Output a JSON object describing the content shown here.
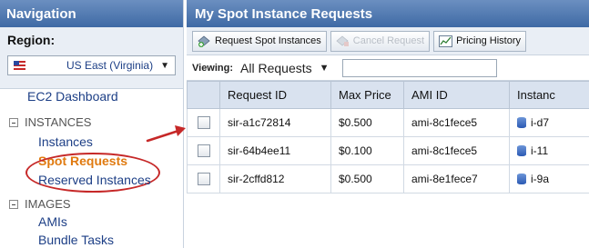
{
  "nav": {
    "title": "Navigation",
    "region_label": "Region:",
    "region_value": "US East (Virginia)",
    "links": {
      "ec2_dashboard": "EC2 Dashboard",
      "instances_section": "INSTANCES",
      "instances": "Instances",
      "spot_requests": "Spot Requests",
      "reserved_instances": "Reserved Instances",
      "images_section": "IMAGES",
      "amis": "AMIs",
      "bundle_tasks": "Bundle Tasks"
    }
  },
  "main": {
    "title": "My Spot Instance Requests",
    "toolbar": {
      "request_spot": "Request Spot Instances",
      "cancel_request": "Cancel Request",
      "pricing_history": "Pricing History"
    },
    "viewing_label": "Viewing:",
    "view_value": "All Requests",
    "filter_value": "",
    "columns": [
      "Request ID",
      "Max Price",
      "AMI ID",
      "Instanc"
    ],
    "rows": [
      {
        "request_id": "sir-a1c72814",
        "max_price": "$0.500",
        "ami_id": "ami-8c1fece5",
        "instance": "i-d7"
      },
      {
        "request_id": "sir-64b4ee11",
        "max_price": "$0.100",
        "ami_id": "ami-8c1fece5",
        "instance": "i-11"
      },
      {
        "request_id": "sir-2cffd812",
        "max_price": "$0.500",
        "ami_id": "ami-8e1fece7",
        "instance": "i-9a"
      }
    ]
  },
  "colors": {
    "header_blue": "#3f6aa5",
    "panel_bg": "#e9eef5",
    "highlight_red": "#c62828",
    "active_link": "#e07a10",
    "link_blue": "#1d3f86"
  }
}
